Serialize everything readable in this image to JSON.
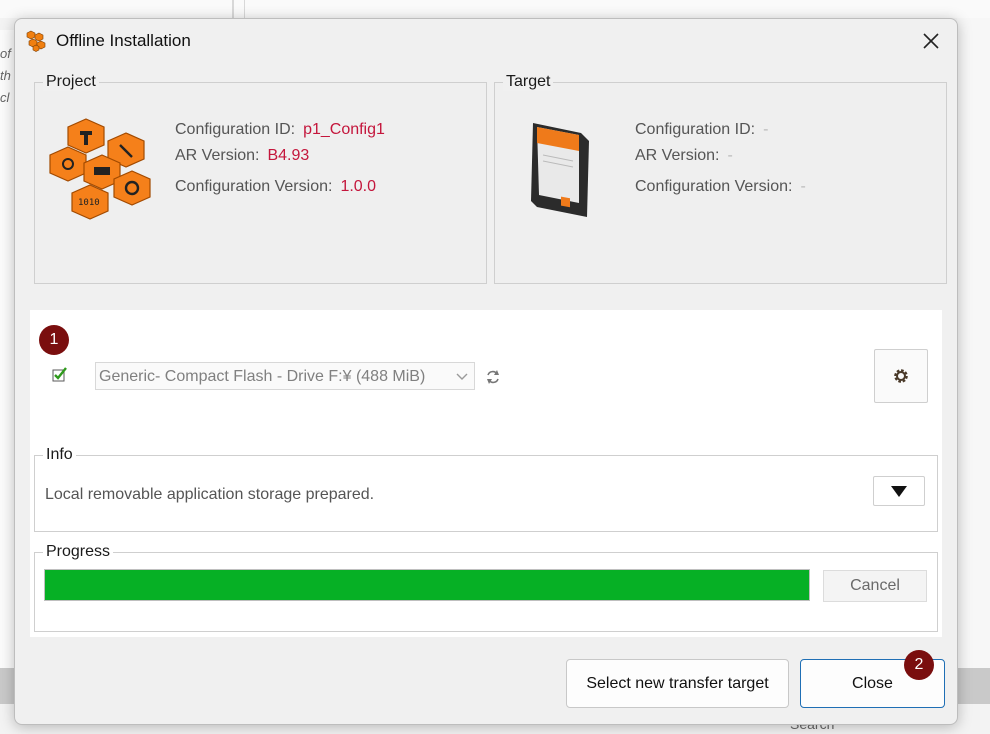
{
  "background": {
    "left_text_lines": [
      "of",
      "th",
      "cl"
    ],
    "search_label": "Search"
  },
  "dialog": {
    "title": "Offline Installation",
    "icons": {
      "app": "orange-hexagons-icon",
      "close": "close-icon"
    }
  },
  "project": {
    "label": "Project",
    "configuration_id_label": "Configuration ID:",
    "configuration_id": "p1_Config1",
    "ar_version_label": "AR Version:",
    "ar_version": "B4.93",
    "configuration_version_label": "Configuration Version:",
    "configuration_version": "1.0.0"
  },
  "target": {
    "label": "Target",
    "configuration_id_label": "Configuration ID:",
    "configuration_id": "-",
    "ar_version_label": "AR Version:",
    "ar_version": "-",
    "configuration_version_label": "Configuration Version:",
    "configuration_version": "-"
  },
  "transfer": {
    "badge_1": "1",
    "drive_selected": "Generic- Compact Flash - Drive F:¥ (488 MiB)"
  },
  "info": {
    "label": "Info",
    "text": "Local removable application storage prepared."
  },
  "progress": {
    "label": "Progress",
    "fraction": 1.0,
    "cancel_label": "Cancel"
  },
  "footer": {
    "select_target_label": "Select new transfer target",
    "close_label": "Close",
    "badge_2": "2"
  },
  "colors": {
    "accent_value": "#c4163c",
    "progress_green": "#06b025",
    "badge_red": "#7a0e0e",
    "primary_border": "#1f6fb5"
  }
}
